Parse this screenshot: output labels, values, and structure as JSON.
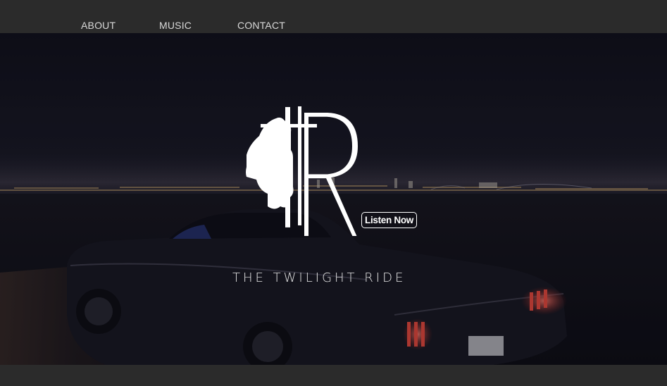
{
  "nav": {
    "items": [
      {
        "label": "ABOUT"
      },
      {
        "label": "MUSIC"
      },
      {
        "label": "CONTACT"
      }
    ]
  },
  "hero": {
    "logo_text": "TR",
    "tagline": "THE TWILIGHT RIDE",
    "cta_label": "Listen Now",
    "background": "night-city-skyline-with-classic-car"
  },
  "colors": {
    "nav_bg": "#2b2b2b",
    "nav_text": "#d9d9d9",
    "hero_overlay": "#0d0d16",
    "logo": "#ffffff",
    "tail_light": "#e0463a"
  }
}
